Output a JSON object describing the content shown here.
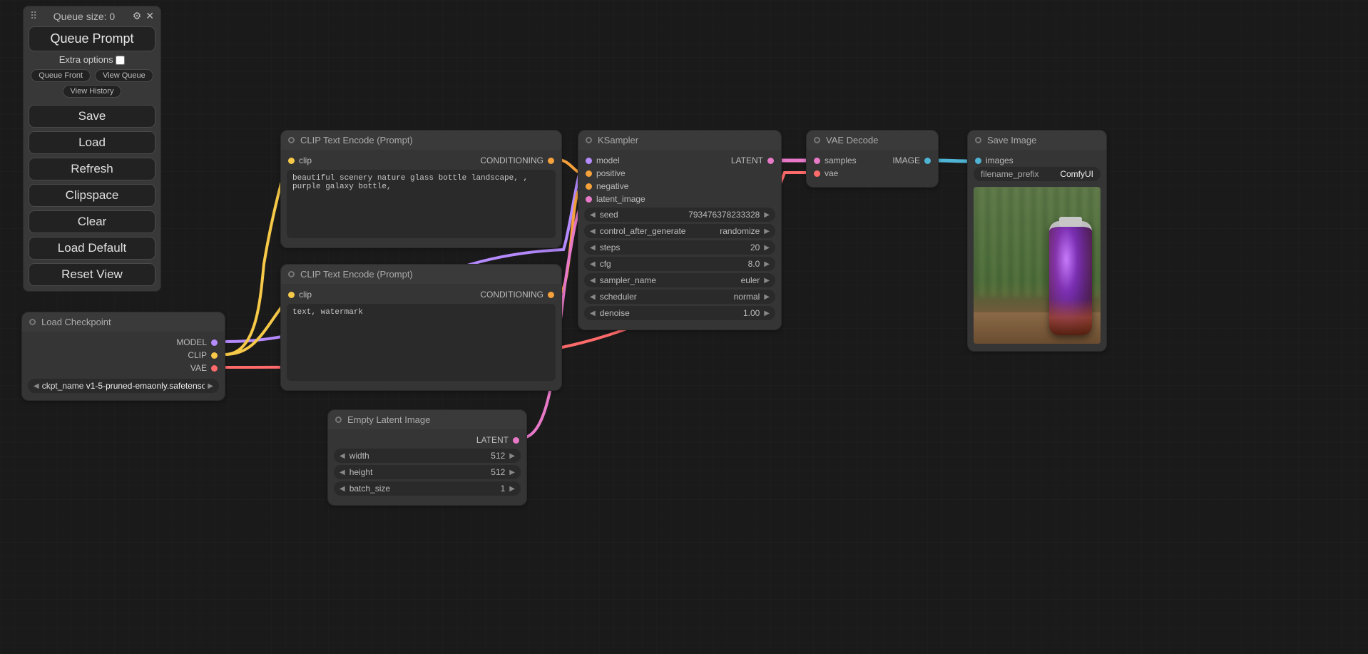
{
  "panel": {
    "queue_size_label": "Queue size: 0",
    "queue_prompt": "Queue Prompt",
    "extra_options": "Extra options",
    "queue_front": "Queue Front",
    "view_queue": "View Queue",
    "view_history": "View History",
    "buttons": [
      "Save",
      "Load",
      "Refresh",
      "Clipspace",
      "Clear",
      "Load Default",
      "Reset View"
    ]
  },
  "nodes": {
    "load_ckpt": {
      "title": "Load Checkpoint",
      "outputs": [
        "MODEL",
        "CLIP",
        "VAE"
      ],
      "param_name": "ckpt_name",
      "param_value": "v1-5-pruned-emaonly.safetensors"
    },
    "clip_pos": {
      "title": "CLIP Text Encode (Prompt)",
      "input": "clip",
      "output": "CONDITIONING",
      "text": "beautiful scenery nature glass bottle landscape, , purple galaxy bottle,"
    },
    "clip_neg": {
      "title": "CLIP Text Encode (Prompt)",
      "input": "clip",
      "output": "CONDITIONING",
      "text": "text, watermark"
    },
    "empty_latent": {
      "title": "Empty Latent Image",
      "output": "LATENT",
      "params": [
        {
          "name": "width",
          "value": "512"
        },
        {
          "name": "height",
          "value": "512"
        },
        {
          "name": "batch_size",
          "value": "1"
        }
      ]
    },
    "ksampler": {
      "title": "KSampler",
      "inputs": [
        "model",
        "positive",
        "negative",
        "latent_image"
      ],
      "output": "LATENT",
      "params": [
        {
          "name": "seed",
          "value": "793476378233328"
        },
        {
          "name": "control_after_generate",
          "value": "randomize"
        },
        {
          "name": "steps",
          "value": "20"
        },
        {
          "name": "cfg",
          "value": "8.0"
        },
        {
          "name": "sampler_name",
          "value": "euler"
        },
        {
          "name": "scheduler",
          "value": "normal"
        },
        {
          "name": "denoise",
          "value": "1.00"
        }
      ]
    },
    "vae_decode": {
      "title": "VAE Decode",
      "inputs": [
        "samples",
        "vae"
      ],
      "output": "IMAGE"
    },
    "save_image": {
      "title": "Save Image",
      "input": "images",
      "prefix_label": "filename_prefix",
      "prefix_value": "ComfyUI"
    }
  }
}
